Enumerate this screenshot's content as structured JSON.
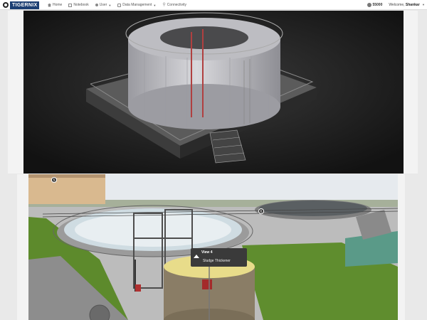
{
  "brand": {
    "name": "TIGERNIX",
    "logo_icon": "tiger-logo-icon"
  },
  "nav": {
    "items": [
      {
        "label": "Home",
        "icon": "home-icon",
        "dropdown": false
      },
      {
        "label": "Notebook",
        "icon": "notebook-icon",
        "dropdown": false
      },
      {
        "label": "User",
        "icon": "user-icon",
        "dropdown": true
      },
      {
        "label": "Data Management",
        "icon": "database-icon",
        "dropdown": true
      },
      {
        "label": "Connectivity",
        "icon": "link-icon",
        "dropdown": false
      }
    ]
  },
  "account": {
    "balance": "55000",
    "welcome_prefix": "Welcome,",
    "username": "Shankar"
  },
  "viewer2": {
    "tooltip": {
      "title": "View 4",
      "subtitle": "Sludge Thickener"
    },
    "hotspots": [
      "5",
      "6"
    ]
  },
  "colors": {
    "brand_blue": "#1c3f73",
    "tank_top": "#e8dc8a",
    "grass": "#5d8a2c"
  }
}
